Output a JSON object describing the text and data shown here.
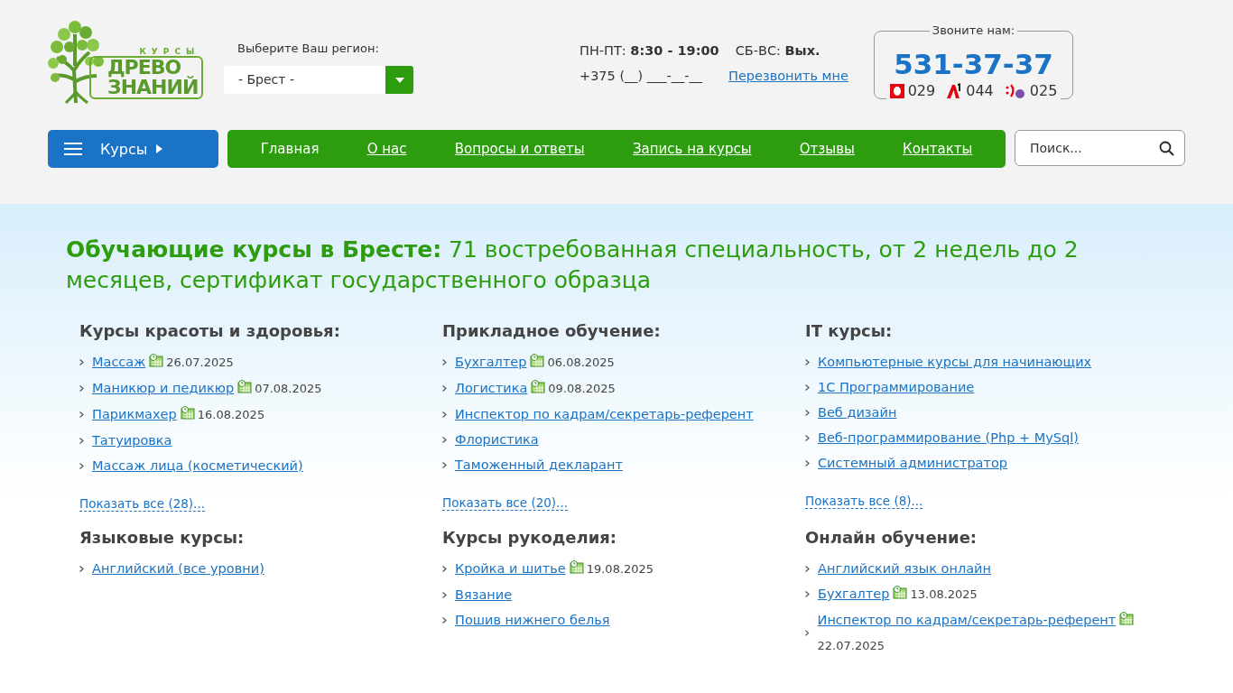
{
  "logo": {
    "top": "КУРСЫ",
    "line1": "ДРЕВО",
    "line2": "ЗНАНИЙ"
  },
  "region": {
    "label": "Выберите Ваш регион:",
    "value": "- Брест -"
  },
  "hours": [
    {
      "days": "ПН-ПТ:",
      "time": "8:30 - 19:00"
    },
    {
      "days": "СБ-ВС:",
      "time": "Вых."
    }
  ],
  "phone_input": {
    "placeholder": "+375 (__) ___-__-__"
  },
  "callback_link": "Перезвонить мне",
  "call_box": {
    "legend": "Звоните нам:",
    "number": "531-37-37",
    "operators": [
      {
        "kind": "mts",
        "code": "029"
      },
      {
        "kind": "a1",
        "code": "044"
      },
      {
        "kind": "life",
        "code": "025"
      }
    ]
  },
  "courses_button": "Курсы",
  "nav": [
    {
      "label": "Главная",
      "selected": true
    },
    {
      "label": "О нас",
      "selected": false
    },
    {
      "label": "Вопросы и ответы",
      "selected": false
    },
    {
      "label": "Запись на курсы",
      "selected": false
    },
    {
      "label": "Отзывы",
      "selected": false
    },
    {
      "label": "Контакты",
      "selected": false
    }
  ],
  "search": {
    "placeholder": "Поиск..."
  },
  "heading": {
    "bold": "Обучающие курсы в Бресте:",
    "rest": "71 востребованная специальность, от 2 недель до 2 месяцев, сертификат государственного образца"
  },
  "sections": [
    {
      "title": "Курсы красоты и здоровья:",
      "items": [
        {
          "label": "Массаж",
          "date": "26.07.2025"
        },
        {
          "label": "Маникюр и педикюр",
          "date": "07.08.2025"
        },
        {
          "label": "Парикмахер",
          "date": "16.08.2025"
        },
        {
          "label": "Татуировка"
        },
        {
          "label": "Массаж лица (косметический)"
        }
      ],
      "show_all": "Показать все (28)..."
    },
    {
      "title": "Прикладное обучение:",
      "items": [
        {
          "label": "Бухгалтер",
          "date": "06.08.2025"
        },
        {
          "label": "Логистика",
          "date": "09.08.2025"
        },
        {
          "label": "Инспектор по кадрам/секретарь-референт"
        },
        {
          "label": "Флористика"
        },
        {
          "label": "Таможенный декларант"
        }
      ],
      "show_all": "Показать все (20)..."
    },
    {
      "title": "IT курсы:",
      "items": [
        {
          "label": "Компьютерные курсы для начинающих"
        },
        {
          "label": "1С Программирование"
        },
        {
          "label": "Веб дизайн"
        },
        {
          "label": "Веб-программирование (Php + MySql)"
        },
        {
          "label": "Системный администратор"
        }
      ],
      "show_all": "Показать все (8)..."
    },
    {
      "title": "Языковые курсы:",
      "items": [
        {
          "label": "Английский (все уровни)"
        }
      ]
    },
    {
      "title": "Курсы рукоделия:",
      "items": [
        {
          "label": "Кройка и шитье",
          "date": "19.08.2025"
        },
        {
          "label": "Вязание"
        },
        {
          "label": "Пошив нижнего белья"
        }
      ]
    },
    {
      "title": "Онлайн обучение:",
      "items": [
        {
          "label": "Английский язык онлайн"
        },
        {
          "label": "Бухгалтер",
          "date": "13.08.2025"
        },
        {
          "label": "Инспектор по кадрам/секретарь-референт",
          "date": "22.07.2025"
        }
      ]
    }
  ]
}
